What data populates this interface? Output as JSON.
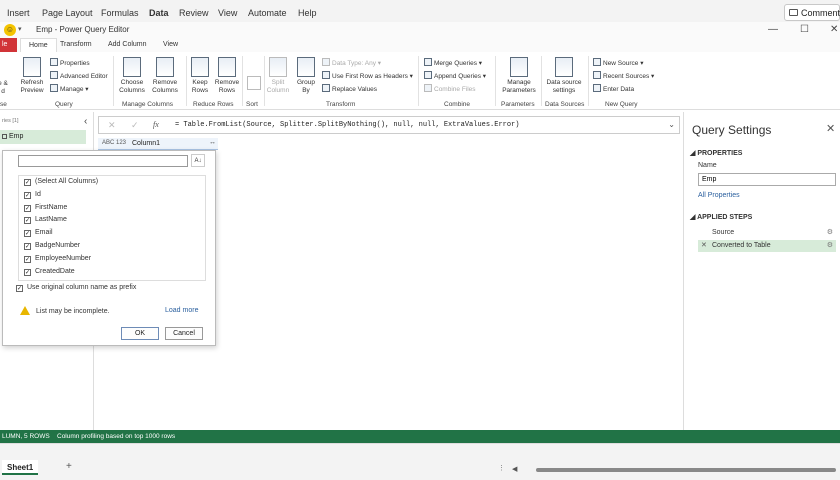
{
  "excel_menu": [
    "Insert",
    "Page Layout",
    "Formulas",
    "Data",
    "Review",
    "View",
    "Automate",
    "Help"
  ],
  "comments_label": "Comments",
  "pq_title": "Emp - Power Query Editor",
  "tabs": {
    "file": "le",
    "home": "Home",
    "transform": "Transform",
    "add_column": "Add Column",
    "view": "View"
  },
  "ribbon": {
    "close_load": "e &\nd",
    "close_group": "se",
    "refresh_preview": "Refresh\nPreview",
    "properties": "Properties",
    "advanced_editor": "Advanced Editor",
    "manage": "Manage",
    "query_group": "Query",
    "choose_columns": "Choose\nColumns",
    "remove_columns": "Remove\nColumns",
    "manage_columns_group": "Manage Columns",
    "keep_rows": "Keep\nRows",
    "remove_rows": "Remove\nRows",
    "reduce_rows_group": "Reduce Rows",
    "sort_group": "Sort",
    "split_column": "Split\nColumn",
    "group_by": "Group\nBy",
    "data_type": "Data Type: Any",
    "use_first_row": "Use First Row as Headers",
    "replace_values": "Replace Values",
    "transform_group": "Transform",
    "merge_queries": "Merge Queries",
    "append_queries": "Append Queries",
    "combine_files": "Combine Files",
    "combine_group": "Combine",
    "manage_parameters": "Manage\nParameters",
    "parameters_group": "Parameters",
    "data_source_settings": "Data source\nsettings",
    "data_sources_group": "Data Sources",
    "new_source": "New Source",
    "recent_sources": "Recent Sources",
    "enter_data": "Enter Data",
    "new_query_group": "New Query"
  },
  "queries": {
    "header": "ries [1]",
    "items": [
      "Emp"
    ]
  },
  "formula": "= Table.FromList(Source, Splitter.SplitByNothing(), null, null, ExtraValues.Error)",
  "column": {
    "type": "ABC 123",
    "name": "Column1"
  },
  "expand_popup": {
    "search_value": "",
    "columns": [
      "(Select All Columns)",
      "Id",
      "FirstName",
      "LastName",
      "Email",
      "BadgeNumber",
      "EmployeeNumber",
      "CreatedDate"
    ],
    "prefix_label": "Use original column name as prefix",
    "warning": "List may be incomplete.",
    "load_more": "Load more",
    "ok": "OK",
    "cancel": "Cancel"
  },
  "query_settings": {
    "title": "Query Settings",
    "properties": "PROPERTIES",
    "name_label": "Name",
    "name_value": "Emp",
    "all_properties": "All Properties",
    "applied_steps": "APPLIED STEPS",
    "steps": [
      "Source",
      "Converted to Table"
    ]
  },
  "status": {
    "left": "LUMN, 5 ROWS",
    "profiling": "Column profiling based on top 1000 rows"
  },
  "sheet": {
    "name": "Sheet1"
  },
  "colors": {
    "excel_green": "#217346",
    "file_red": "#d13438",
    "selection_green": "#d7ebd9"
  }
}
